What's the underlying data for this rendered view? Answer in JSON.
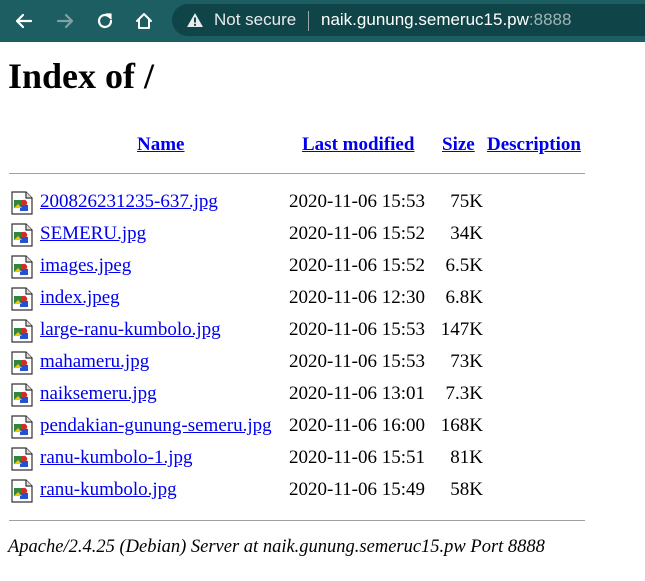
{
  "browser": {
    "security_label": "Not secure",
    "url_host": "naik.gunung.semeruc15.pw",
    "url_port": ":8888"
  },
  "page": {
    "title": "Index of /",
    "columns": {
      "name": "Name",
      "last_modified": "Last modified",
      "size": "Size",
      "description": "Description"
    },
    "files": [
      {
        "name": "200826231235-637.jpg",
        "modified": "2020-11-06 15:53",
        "size": "75K"
      },
      {
        "name": "SEMERU.jpg",
        "modified": "2020-11-06 15:52",
        "size": "34K"
      },
      {
        "name": "images.jpeg",
        "modified": "2020-11-06 15:52",
        "size": "6.5K"
      },
      {
        "name": "index.jpeg",
        "modified": "2020-11-06 12:30",
        "size": "6.8K"
      },
      {
        "name": "large-ranu-kumbolo.jpg",
        "modified": "2020-11-06 15:53",
        "size": "147K"
      },
      {
        "name": "mahameru.jpg",
        "modified": "2020-11-06 15:53",
        "size": "73K"
      },
      {
        "name": "naiksemeru.jpg",
        "modified": "2020-11-06 13:01",
        "size": "7.3K"
      },
      {
        "name": "pendakian-gunung-semeru.jpg",
        "modified": "2020-11-06 16:00",
        "size": "168K"
      },
      {
        "name": "ranu-kumbolo-1.jpg",
        "modified": "2020-11-06 15:51",
        "size": "81K"
      },
      {
        "name": "ranu-kumbolo.jpg",
        "modified": "2020-11-06 15:49",
        "size": "58K"
      }
    ],
    "server_signature": "Apache/2.4.25 (Debian) Server at naik.gunung.semeruc15.pw Port 8888"
  },
  "colors": {
    "toolbar": "#1d5e62",
    "omnibox": "#0f4448",
    "link": "#0000ee"
  }
}
